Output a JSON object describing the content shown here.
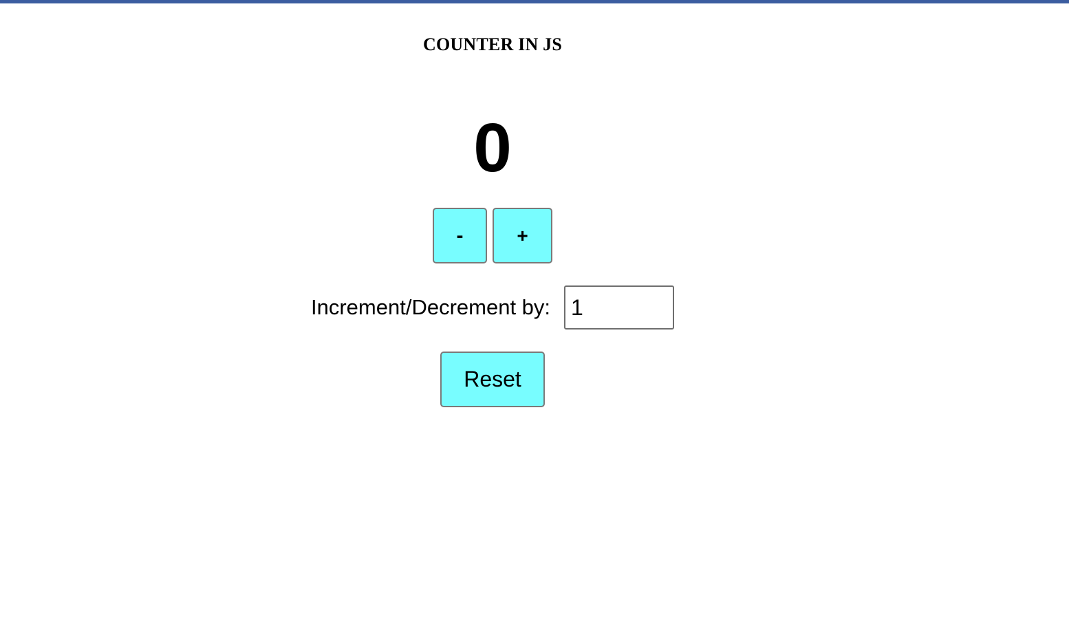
{
  "header": {
    "title": "COUNTER IN JS"
  },
  "counter": {
    "value": "0",
    "decrement_label": "-",
    "increment_label": "+"
  },
  "step": {
    "label": "Increment/Decrement by:",
    "value": "1"
  },
  "reset": {
    "label": "Reset"
  },
  "colors": {
    "button_background": "#78fdff",
    "top_bar": "#3c5da0"
  }
}
